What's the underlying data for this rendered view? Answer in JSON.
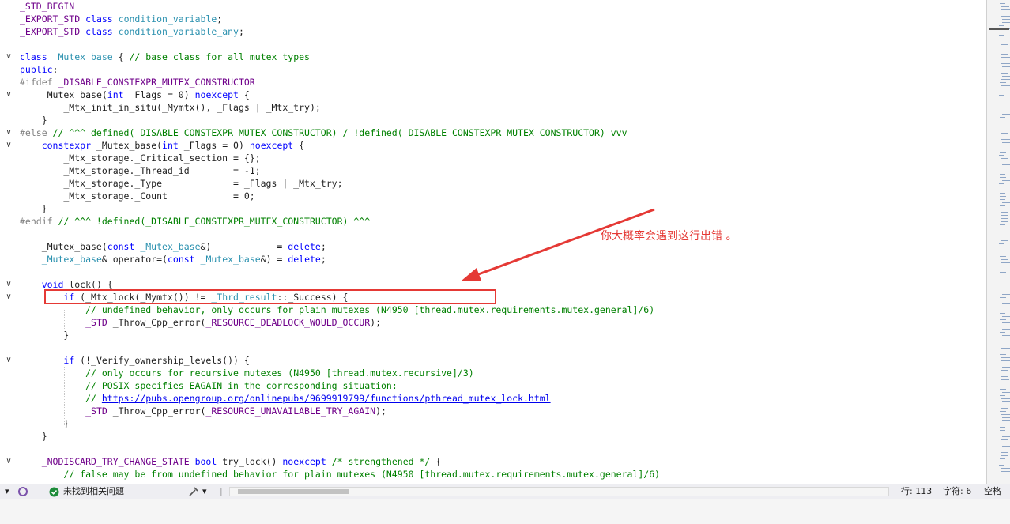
{
  "code_lines": [
    {
      "segs": [
        [
          "mac",
          "_STD_BEGIN"
        ]
      ]
    },
    {
      "segs": [
        [
          "mac",
          "_EXPORT_STD "
        ],
        [
          "kw",
          "class "
        ],
        [
          "ty",
          "condition_variable"
        ],
        [
          "",
          "; "
        ]
      ]
    },
    {
      "segs": [
        [
          "mac",
          "_EXPORT_STD "
        ],
        [
          "kw",
          "class "
        ],
        [
          "ty",
          "condition_variable_any"
        ],
        [
          "",
          ";"
        ]
      ]
    },
    {
      "segs": []
    },
    {
      "segs": [
        [
          "kw",
          "class "
        ],
        [
          "ty",
          "_Mutex_base "
        ],
        [
          "",
          "{ "
        ],
        [
          "cmt",
          "// base class for all mutex types"
        ]
      ]
    },
    {
      "segs": [
        [
          "kw",
          "public"
        ],
        [
          "",
          ":"
        ]
      ]
    },
    {
      "segs": [
        [
          "pp",
          "#ifdef "
        ],
        [
          "mac",
          "_DISABLE_CONSTEXPR_MUTEX_CONSTRUCTOR"
        ]
      ]
    },
    {
      "segs": [
        [
          "",
          "    "
        ],
        [
          "",
          "_Mutex_base("
        ],
        [
          "kw",
          "int "
        ],
        [
          "",
          "_Flags = 0) "
        ],
        [
          "kw",
          "noexcept "
        ],
        [
          "",
          "{"
        ]
      ]
    },
    {
      "segs": [
        [
          "",
          "        _Mtx_init_in_situ(_Mymtx(), _Flags | _Mtx_try);"
        ]
      ]
    },
    {
      "segs": [
        [
          "",
          "    }"
        ]
      ]
    },
    {
      "segs": [
        [
          "pp",
          "#else "
        ],
        [
          "cmt",
          "// ^^^ defined(_DISABLE_CONSTEXPR_MUTEX_CONSTRUCTOR) / !defined(_DISABLE_CONSTEXPR_MUTEX_CONSTRUCTOR) vvv"
        ]
      ]
    },
    {
      "segs": [
        [
          "",
          "    "
        ],
        [
          "kw",
          "constexpr "
        ],
        [
          "",
          "_Mutex_base("
        ],
        [
          "kw",
          "int "
        ],
        [
          "",
          "_Flags = 0) "
        ],
        [
          "kw",
          "noexcept "
        ],
        [
          "",
          "{"
        ]
      ]
    },
    {
      "segs": [
        [
          "",
          "        _Mtx_storage._Critical_section = {};"
        ]
      ]
    },
    {
      "segs": [
        [
          "",
          "        _Mtx_storage._Thread_id        = -1;"
        ]
      ]
    },
    {
      "segs": [
        [
          "",
          "        _Mtx_storage._Type             = _Flags | _Mtx_try;"
        ]
      ]
    },
    {
      "segs": [
        [
          "",
          "        _Mtx_storage._Count            = 0;"
        ]
      ]
    },
    {
      "segs": [
        [
          "",
          "    }"
        ]
      ]
    },
    {
      "segs": [
        [
          "pp",
          "#endif "
        ],
        [
          "cmt",
          "// ^^^ !defined(_DISABLE_CONSTEXPR_MUTEX_CONSTRUCTOR) ^^^"
        ]
      ]
    },
    {
      "segs": []
    },
    {
      "segs": [
        [
          "",
          "    _Mutex_base("
        ],
        [
          "kw",
          "const "
        ],
        [
          "ty",
          "_Mutex_base"
        ],
        [
          "",
          "&)            = "
        ],
        [
          "kw",
          "delete"
        ],
        [
          "",
          ";"
        ]
      ]
    },
    {
      "segs": [
        [
          "",
          "    "
        ],
        [
          "ty",
          "_Mutex_base"
        ],
        [
          "",
          "& operator=("
        ],
        [
          "kw",
          "const "
        ],
        [
          "ty",
          "_Mutex_base"
        ],
        [
          "",
          "&) = "
        ],
        [
          "kw",
          "delete"
        ],
        [
          "",
          ";"
        ]
      ]
    },
    {
      "segs": []
    },
    {
      "segs": [
        [
          "",
          "    "
        ],
        [
          "kw",
          "void "
        ],
        [
          "",
          "lock() {"
        ]
      ]
    },
    {
      "segs": [
        [
          "",
          "        "
        ],
        [
          "kw",
          "if "
        ],
        [
          "",
          "(_Mtx_lock(_Mymtx()) != "
        ],
        [
          "ty",
          "_Thrd_result"
        ],
        [
          "",
          "::_Success) {"
        ]
      ]
    },
    {
      "segs": [
        [
          "",
          "            "
        ],
        [
          "cmt",
          "// undefined behavior, only occurs for plain mutexes (N4950 [thread.mutex.requirements.mutex.general]/6)"
        ]
      ]
    },
    {
      "segs": [
        [
          "",
          "            "
        ],
        [
          "mac",
          "_STD "
        ],
        [
          "",
          "_Throw_Cpp_error("
        ],
        [
          "mac",
          "_RESOURCE_DEADLOCK_WOULD_OCCUR"
        ],
        [
          "",
          ");"
        ]
      ]
    },
    {
      "segs": [
        [
          "",
          "        }"
        ]
      ]
    },
    {
      "segs": []
    },
    {
      "segs": [
        [
          "",
          "        "
        ],
        [
          "kw",
          "if "
        ],
        [
          "",
          "(!_Verify_ownership_levels()) {"
        ]
      ]
    },
    {
      "segs": [
        [
          "",
          "            "
        ],
        [
          "cmt",
          "// only occurs for recursive mutexes (N4950 [thread.mutex.recursive]/3)"
        ]
      ]
    },
    {
      "segs": [
        [
          "",
          "            "
        ],
        [
          "cmt",
          "// POSIX specifies EAGAIN in the corresponding situation:"
        ]
      ]
    },
    {
      "segs": [
        [
          "",
          "            "
        ],
        [
          "cmt",
          "// "
        ],
        [
          "url",
          "https://pubs.opengroup.org/onlinepubs/9699919799/functions/pthread_mutex_lock.html"
        ]
      ]
    },
    {
      "segs": [
        [
          "",
          "            "
        ],
        [
          "mac",
          "_STD "
        ],
        [
          "",
          "_Throw_Cpp_error("
        ],
        [
          "mac",
          "_RESOURCE_UNAVAILABLE_TRY_AGAIN"
        ],
        [
          "",
          ");"
        ]
      ]
    },
    {
      "segs": [
        [
          "",
          "        }"
        ]
      ]
    },
    {
      "segs": [
        [
          "",
          "    }"
        ]
      ]
    },
    {
      "segs": []
    },
    {
      "segs": [
        [
          "",
          "    "
        ],
        [
          "mac",
          "_NODISCARD_TRY_CHANGE_STATE "
        ],
        [
          "kw",
          "bool "
        ],
        [
          "",
          "try_lock() "
        ],
        [
          "kw",
          "noexcept "
        ],
        [
          "cmt",
          "/* strengthened */ "
        ],
        [
          "",
          "{"
        ]
      ]
    },
    {
      "segs": [
        [
          "",
          "        "
        ],
        [
          "cmt",
          "// false may be from undefined behavior for plain mutexes (N4950 [thread.mutex.requirements.mutex.general]/6)"
        ]
      ]
    }
  ],
  "fold_rows": [
    4,
    7,
    10,
    11,
    22,
    23,
    28,
    36
  ],
  "fold_glyph": "∨",
  "annotation": {
    "text": "你大概率会遇到这行出错 。",
    "color": "#e53935"
  },
  "status": {
    "issues_icon": "check-circle-icon",
    "issues_text": "未找到相关问题",
    "line_label": "行: 113",
    "char_label": "字符: 6",
    "indent_label": "空格"
  }
}
